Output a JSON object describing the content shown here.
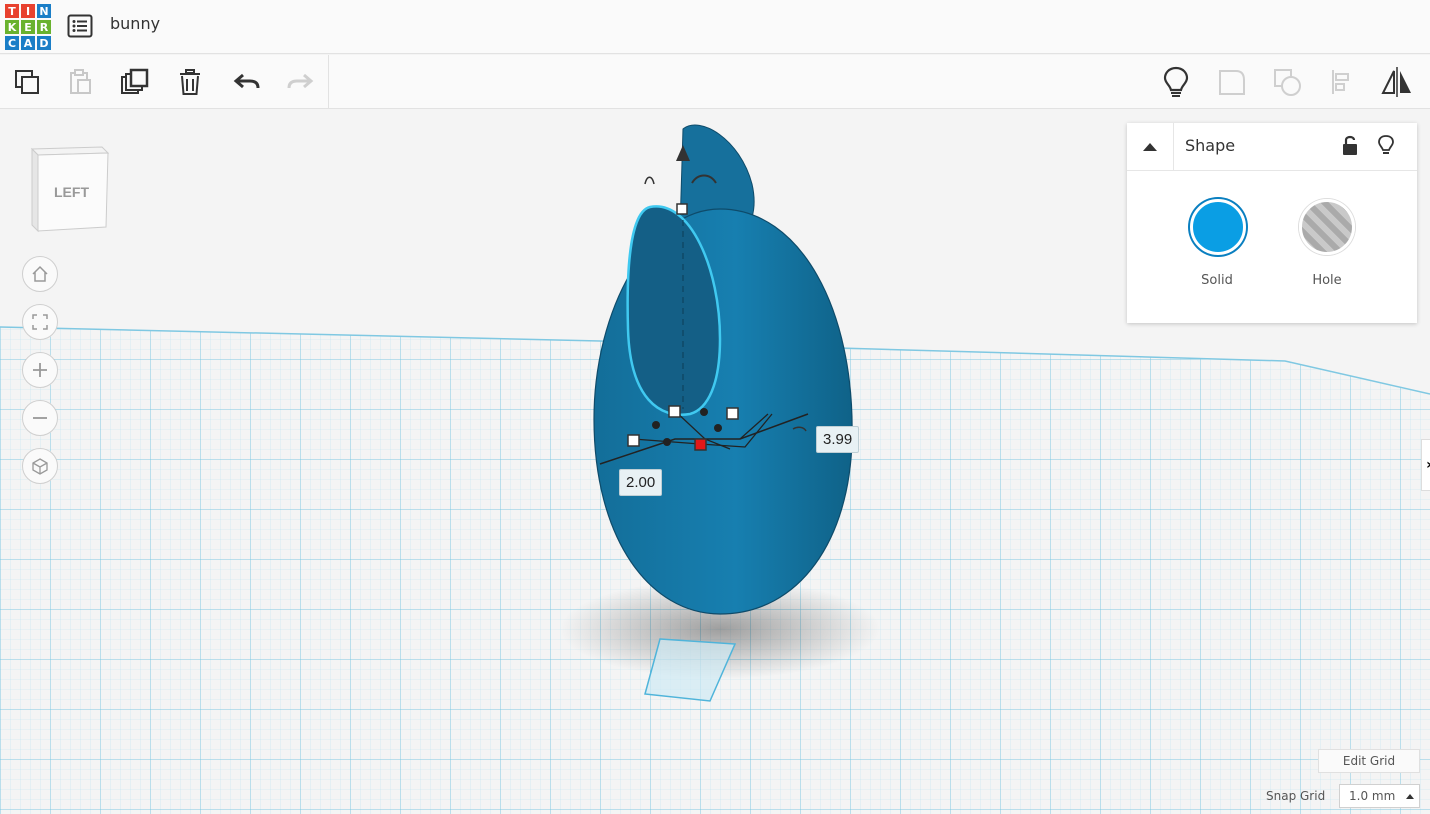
{
  "app": {
    "logo_letters": [
      "T",
      "I",
      "N",
      "K",
      "E",
      "R",
      "C",
      "A",
      "D"
    ],
    "project_title": "bunny"
  },
  "toolbar": {
    "left_tools": [
      "copy-icon",
      "paste-icon",
      "duplicate-icon",
      "trash-icon",
      "undo-icon",
      "redo-icon"
    ],
    "right_tools": [
      "lightbulb-icon",
      "group-icon",
      "ungroup-icon",
      "align-icon",
      "mirror-icon"
    ]
  },
  "viewport": {
    "view_cube_label": "LEFT",
    "dimension_width": "2.00",
    "dimension_height": "3.99"
  },
  "shape_panel": {
    "title": "Shape",
    "solid_label": "Solid",
    "hole_label": "Hole",
    "solid_color": "#0a9ee4"
  },
  "grid": {
    "edit_grid_label": "Edit Grid",
    "snap_grid_label": "Snap Grid",
    "snap_value": "1.0 mm"
  }
}
